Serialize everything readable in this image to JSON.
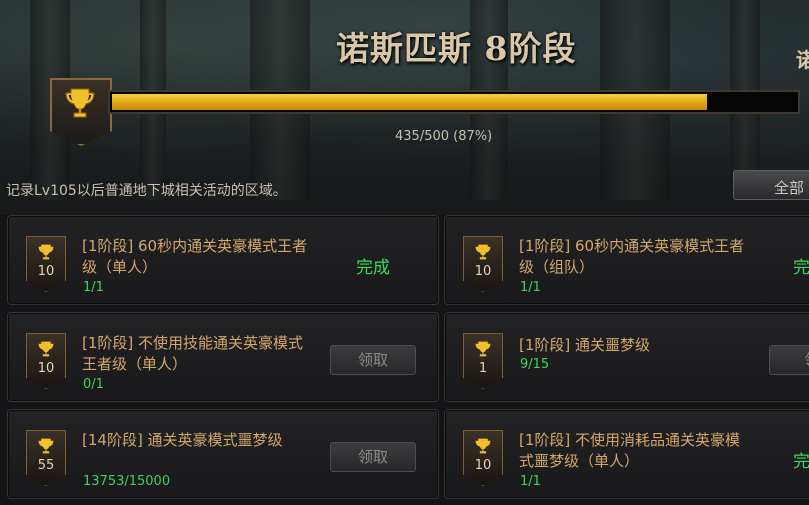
{
  "header": {
    "title": "诺斯匹斯 8阶段",
    "title_right": "诺",
    "progress": {
      "current": 435,
      "total": 500,
      "text": "435/500 (87%)",
      "fraction": 0.87
    },
    "description": "记录Lv105以后普通地下城相关活动的区域。",
    "all_button": "全部"
  },
  "colors": {
    "title": "#d8c8a8",
    "bar": "#e0a914",
    "complete": "#38d85a",
    "progress_count": "#3fd35b",
    "task_title": "#d2a86a"
  },
  "tasks": [
    {
      "badge": "10",
      "title": "[1阶段] 60秒内通关英豪模式王者级（单人）",
      "count": "1/1",
      "status": "完成"
    },
    {
      "badge": "10",
      "title": "[1阶段] 60秒内通关英豪模式王者级（组队）",
      "count": "1/1",
      "status": "完"
    },
    {
      "badge": "10",
      "title": "[1阶段] 不使用技能通关英豪模式王者级（单人）",
      "count": "0/1",
      "status": "领取"
    },
    {
      "badge": "1",
      "title": "[1阶段] 通关噩梦级",
      "count": "9/15",
      "status": "领"
    },
    {
      "badge": "55",
      "title": "[14阶段] 通关英豪模式噩梦级",
      "count": "13753/15000",
      "status": "领取"
    },
    {
      "badge": "10",
      "title": "[1阶段] 不使用消耗品通关英豪模式噩梦级（单人）",
      "count": "1/1",
      "status": "完"
    }
  ]
}
